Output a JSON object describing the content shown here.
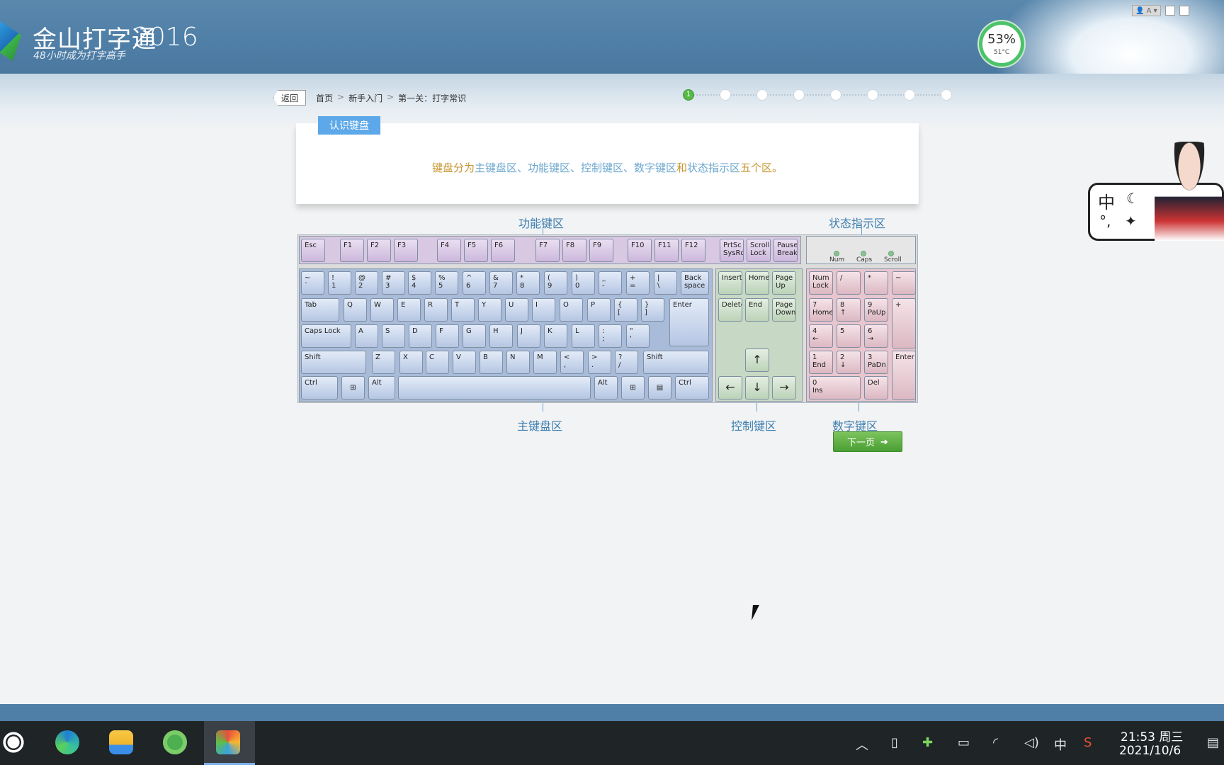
{
  "app": {
    "title": "金山打字通",
    "year": "2016",
    "subtitle": "48小时成为打字高手",
    "gauge_value": "53%",
    "gauge_temp": "51°C"
  },
  "window": {
    "user_label": "A"
  },
  "nav": {
    "back_label": "返回",
    "breadcrumb": [
      "首页",
      "新手入门",
      "第一关：打字常识"
    ],
    "separator": ">",
    "steps_total": 8,
    "current_step_label": "1"
  },
  "card": {
    "tag": "认识键盘",
    "text_parts": [
      {
        "text": "键盘分为",
        "style": "gold"
      },
      {
        "text": "主键盘区、功能键区、控制键区、数字键区",
        "style": "blue"
      },
      {
        "text": "和",
        "style": "gold"
      },
      {
        "text": "状态指示区",
        "style": "blue"
      },
      {
        "text": "五个区。",
        "style": "gold"
      }
    ]
  },
  "zones": {
    "function": "功能键区",
    "status": "状态指示区",
    "main": "主键盘区",
    "control": "控制键区",
    "numeric": "数字键区"
  },
  "keyboard": {
    "function_row": [
      "Esc",
      "F1",
      "F2",
      "F3",
      "F4",
      "F5",
      "F6",
      "F7",
      "F8",
      "F9",
      "F10",
      "F11",
      "F12",
      "PrtSc\nSysRq",
      "Scroll\nLock",
      "Pause\nBreak"
    ],
    "indicators": [
      "Num",
      "Caps",
      "Scroll"
    ],
    "main_rows": [
      [
        "~\n`",
        "!\n1",
        "@\n2",
        "#\n3",
        "$\n4",
        "%\n5",
        "^\n6",
        "&\n7",
        "*\n8",
        "(\n9",
        ")\n0",
        "_\n-",
        "+\n=",
        "|\n\\",
        "Back\nspace"
      ],
      [
        "Tab",
        "Q",
        "W",
        "E",
        "R",
        "T",
        "Y",
        "U",
        "I",
        "O",
        "P",
        "{\n[",
        "}\n]",
        "Enter"
      ],
      [
        "Caps Lock",
        "A",
        "S",
        "D",
        "F",
        "G",
        "H",
        "J",
        "K",
        "L",
        ":\n;",
        "\"\n'"
      ],
      [
        "Shift",
        "Z",
        "X",
        "C",
        "V",
        "B",
        "N",
        "M",
        "<\n,",
        ">\n.",
        "?\n/",
        "Shift"
      ],
      [
        "Ctrl",
        "win-logo",
        "Alt",
        "",
        "Alt",
        "win-logo",
        "menu-key",
        "Ctrl"
      ]
    ],
    "control_keys": [
      "Insert",
      "Home",
      "Page\nUp",
      "Delete",
      "End",
      "Page\nDown",
      "↑",
      "←",
      "↓",
      "→"
    ],
    "numeric_keys": [
      "Num\nLock",
      "/",
      "*",
      "−",
      "7\nHome",
      "8\n↑",
      "9\nPaUp",
      "+",
      "4\n←",
      "5",
      "6\n→",
      "1\nEnd",
      "2\n↓",
      "3\nPaDn",
      "Enter",
      "0\nIns",
      "Del"
    ]
  },
  "next_button": {
    "label": "下一页",
    "icon": "arrow-right-icon"
  },
  "mascot": {
    "char": "中",
    "symbols": "°,"
  },
  "taskbar": {
    "apps": [
      "start-icon",
      "edge-icon",
      "file-explorer-icon",
      "ie-icon",
      "typing-app-icon"
    ],
    "tray_ime": "中",
    "time": "21:53 周三",
    "date": "2021/10/6"
  },
  "colors": {
    "header": "#4f7ea6",
    "accent_gold": "#c7962f",
    "accent_blue": "#6ca7cf",
    "zone_label": "#3d7fb0",
    "next_green": "#4a9f34"
  }
}
